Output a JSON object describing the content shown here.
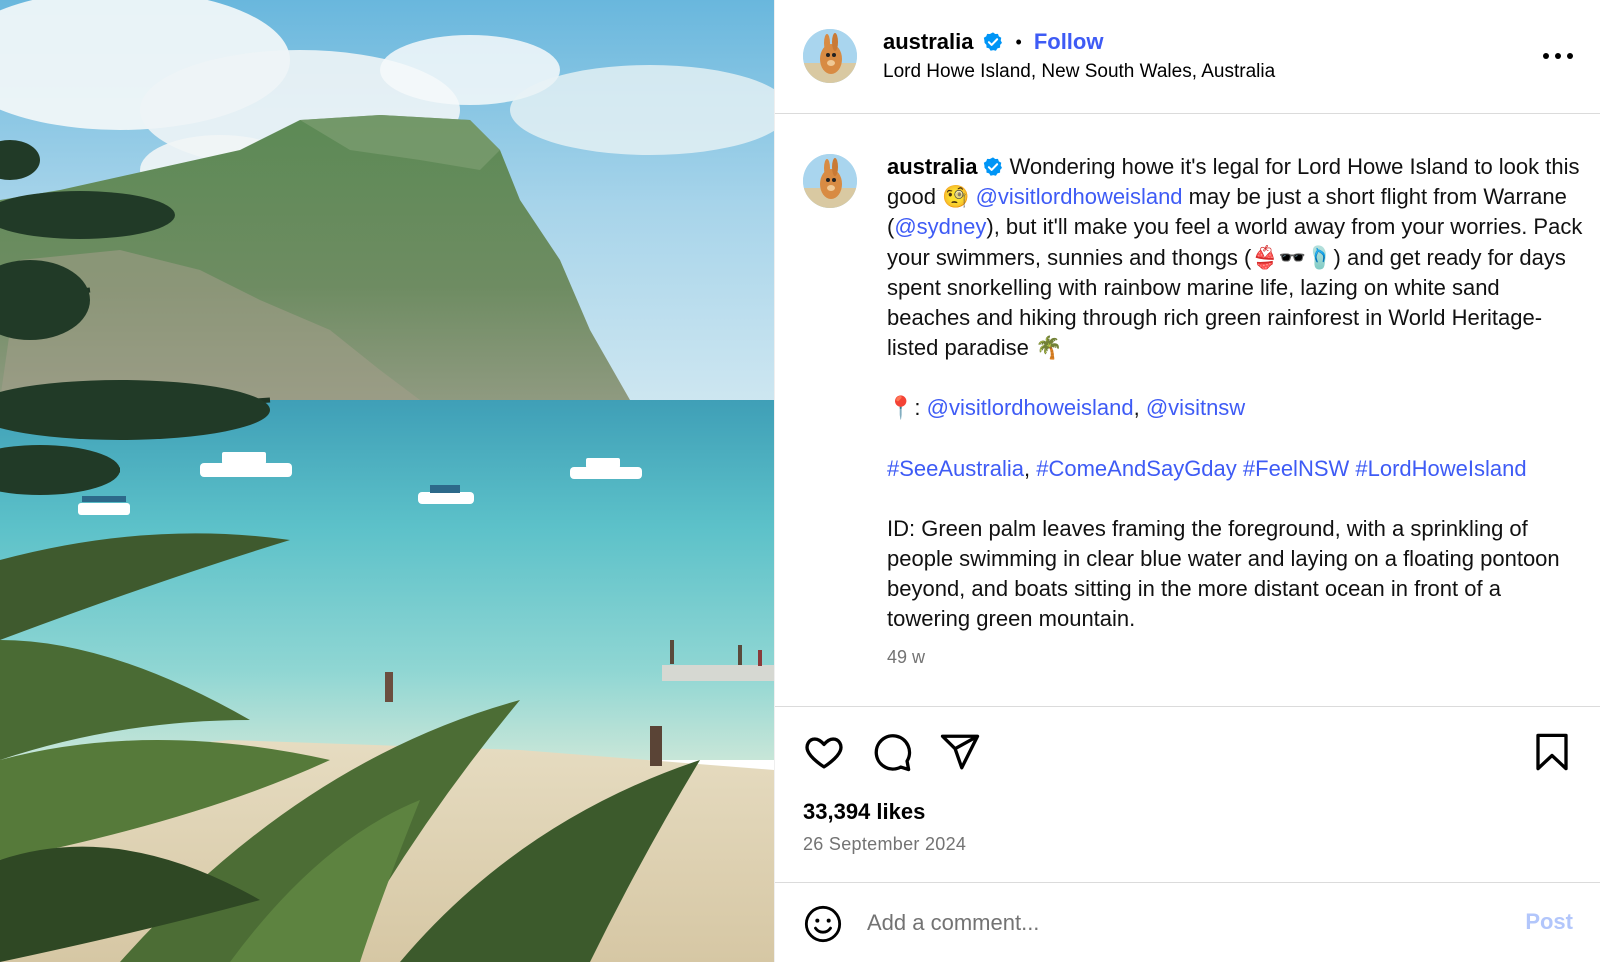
{
  "post": {
    "username": "australia",
    "verified": true,
    "follow_label": "Follow",
    "location": "Lord Howe Island, New South Wales, Australia",
    "caption": {
      "username": "australia",
      "line_parts": {
        "p1_a": "Wondering howe it's legal for Lord Howe Island to look this good 🧐 ",
        "p1_mention1": "@visitlordhoweisland",
        "p1_b": " may be just a short flight from Warrane (",
        "p1_mention2": "@sydney",
        "p1_c": "), but it'll make you feel a world away from your worries. Pack your swimmers, sunnies and thongs (👙🕶️🩴) and get ready for days spent snorkelling with rainbow marine life, lazing on white sand beaches and hiking through rich green rainforest in World Heritage-listed paradise 🌴",
        "p2_pin": "📍: ",
        "p2_mention1": "@visitlordhoweisland",
        "p2_sep": ", ",
        "p2_mention2": "@visitnsw",
        "p3_tag1": "#SeeAustralia",
        "p3_sep": ", ",
        "p3_tag2": "#ComeAndSayGday",
        "p3_tag3": "#FeelNSW",
        "p3_tag4": "#LordHoweIsland",
        "p4": "ID: Green palm leaves framing the foreground, with a sprinkling of people swimming in clear blue water and laying on a floating pontoon beyond, and boats sitting in the more distant ocean in front of a towering green mountain."
      },
      "time_ago": "49 w"
    },
    "likes": "33,394 likes",
    "date": "26 September 2024"
  },
  "comment_box": {
    "placeholder": "Add a comment...",
    "post_label": "Post"
  },
  "icons": {
    "more": "more-options-icon",
    "like": "heart-icon",
    "comment": "comment-bubble-icon",
    "share": "paper-plane-icon",
    "save": "bookmark-icon",
    "emoji": "smiley-icon",
    "verified": "verified-badge-icon"
  },
  "colors": {
    "link_blue": "#3e5bf5",
    "verified_blue": "#0095f6",
    "muted_text": "#737373",
    "post_button_disabled": "#b2c6fb",
    "divider": "#dbdbdb"
  }
}
